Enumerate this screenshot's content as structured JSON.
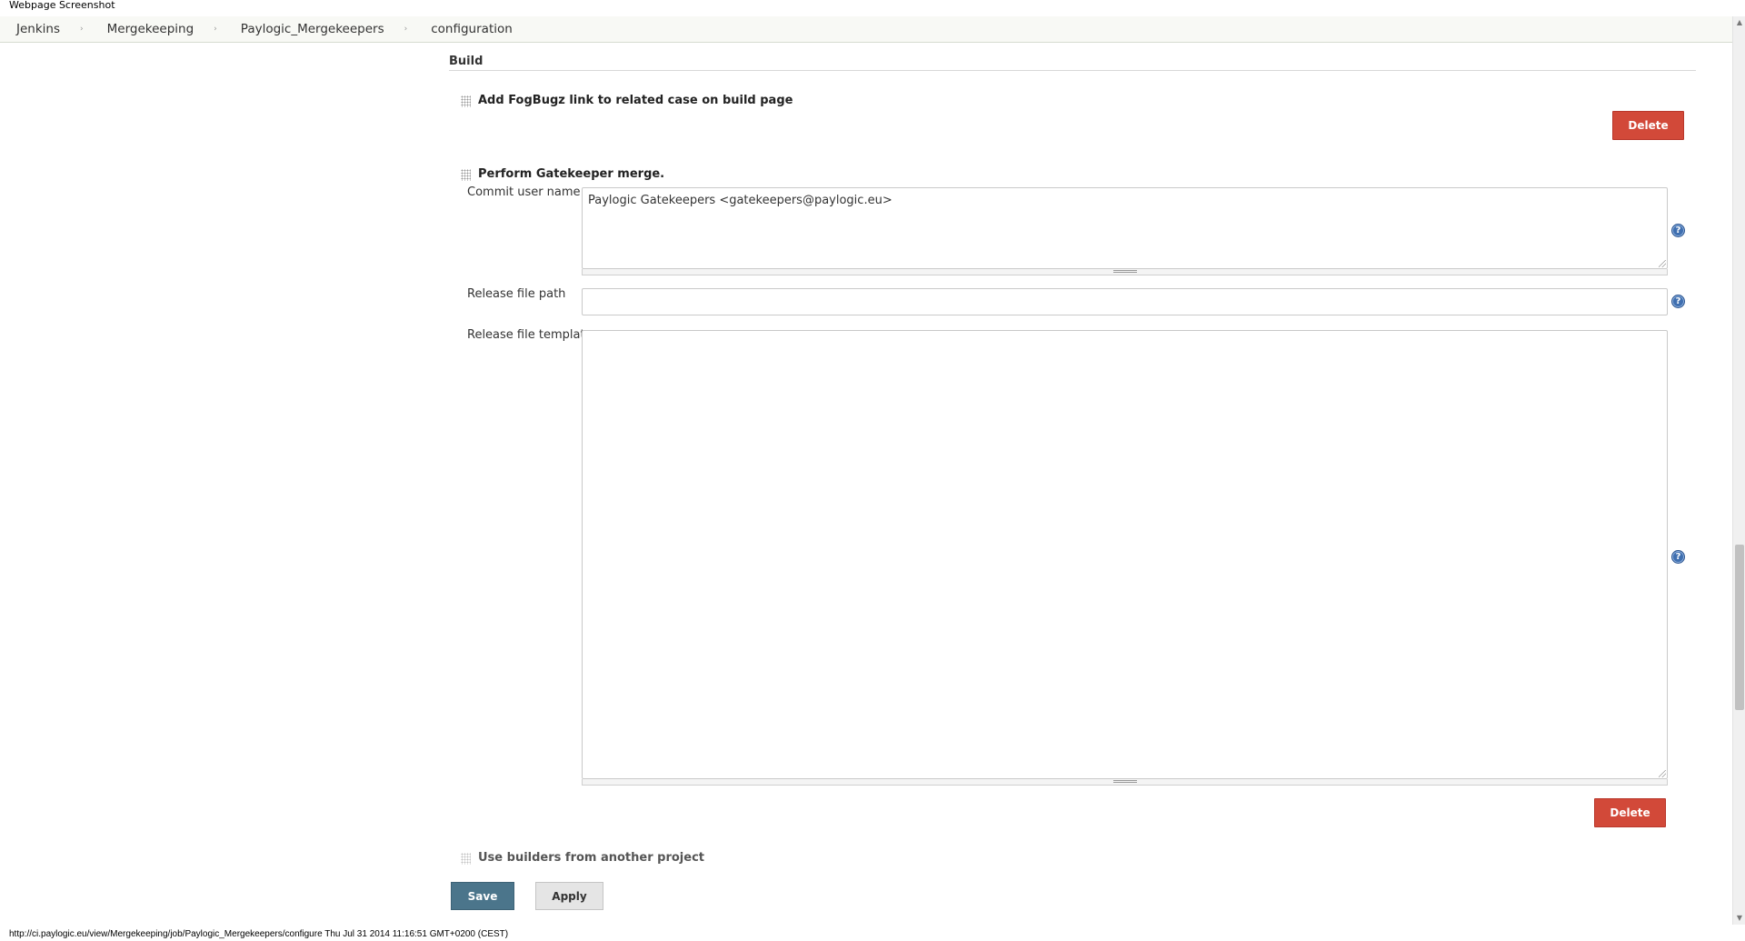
{
  "window": {
    "caption": "Webpage Screenshot"
  },
  "breadcrumb": {
    "items": [
      "Jenkins",
      "Mergekeeping",
      "Paylogic_Mergekeepers",
      "configuration"
    ],
    "separator": "›"
  },
  "section": {
    "title": "Build"
  },
  "steps": {
    "fogbugz": {
      "title": "Add FogBugz link to related case on build page",
      "delete_label": "Delete"
    },
    "gatekeeper": {
      "title": "Perform Gatekeeper merge.",
      "commit_user_label": "Commit user name",
      "commit_user_value": "Paylogic Gatekeepers <gatekeepers@paylogic.eu>",
      "release_path_label": "Release file path",
      "release_path_value": "",
      "release_template_label": "Release file template",
      "release_template_value": "",
      "delete_label": "Delete"
    },
    "builders": {
      "title": "Use builders from another project"
    }
  },
  "actions": {
    "save_label": "Save",
    "apply_label": "Apply"
  },
  "help_icon_glyph": "?",
  "status": {
    "text": "http://ci.paylogic.eu/view/Mergekeeping/job/Paylogic_Mergekeepers/configure Thu Jul 31 2014 11:16:51 GMT+0200 (CEST)"
  },
  "icons": {
    "help": "help-icon",
    "handle": "drag-handle-icon",
    "grip": "resize-grip-icon"
  },
  "colors": {
    "delete": "#d24939",
    "save": "#4b758b",
    "help": "#3f6fb0"
  }
}
